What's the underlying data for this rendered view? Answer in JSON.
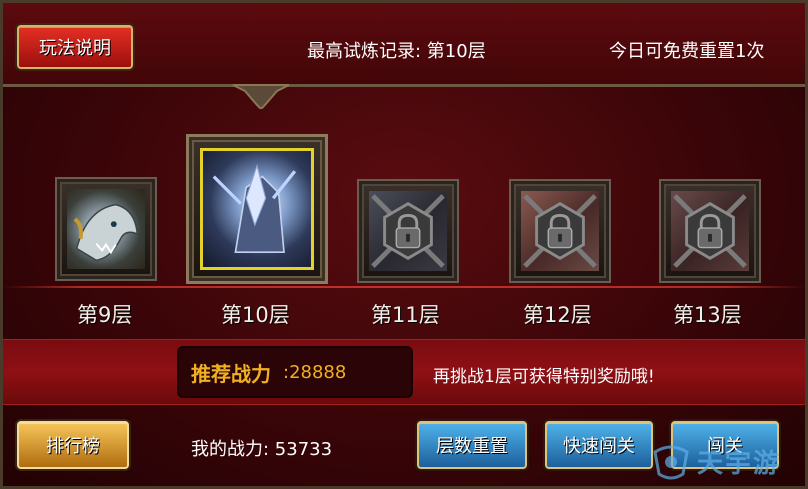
{
  "header": {
    "rules_button": "玩法说明",
    "best_record": "最高试炼记录: 第10层",
    "free_reset": "今日可免费重置1次"
  },
  "floors": [
    {
      "label": "第9层",
      "state": "cleared"
    },
    {
      "label": "第10层",
      "state": "current"
    },
    {
      "label": "第11层",
      "state": "locked"
    },
    {
      "label": "第12层",
      "state": "locked"
    },
    {
      "label": "第13层",
      "state": "locked"
    }
  ],
  "recommend": {
    "label": "推荐战力",
    "value": ":28888"
  },
  "challenge_tip": "再挑战1层可获得特别奖励哦!",
  "bottom": {
    "rank_button": "排行榜",
    "my_power": "我的战力: 53733",
    "reset_button": "层数重置",
    "fast_button": "快速闯关",
    "go_button": "闯关"
  },
  "watermark": "天宇游",
  "colors": {
    "gold_text": "#f0b020",
    "current_frame": "#e4d22a",
    "background": "#3a0508"
  }
}
